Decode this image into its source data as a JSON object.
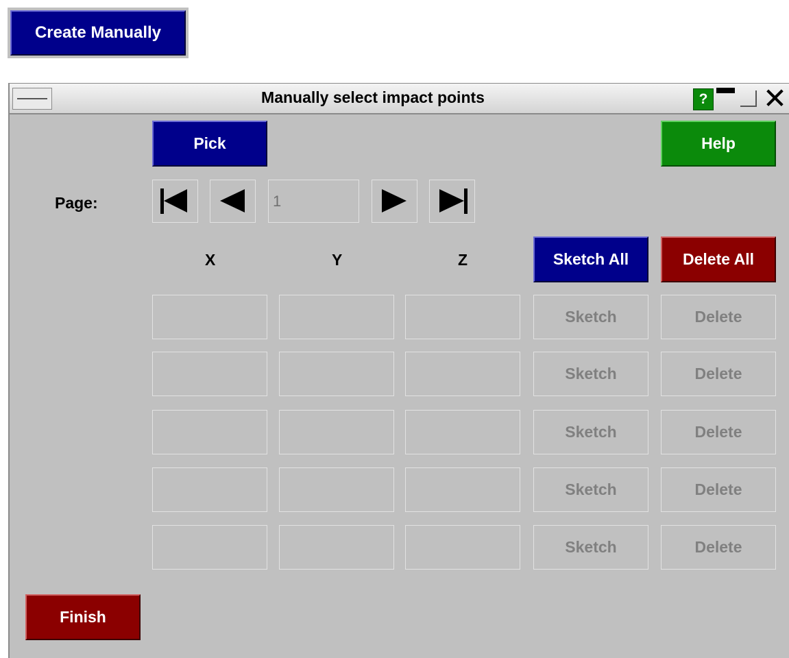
{
  "top_button": {
    "label": "Create Manually"
  },
  "window": {
    "title": "Manually select impact points",
    "help_icon": "?",
    "close_icon": "✕"
  },
  "buttons": {
    "pick": "Pick",
    "help": "Help",
    "sketch_all": "Sketch All",
    "delete_all": "Delete All",
    "finish": "Finish"
  },
  "pager": {
    "label": "Page:",
    "value": "1"
  },
  "columns": {
    "x": "X",
    "y": "Y",
    "z": "Z"
  },
  "rows": [
    {
      "x": "",
      "y": "",
      "z": "",
      "sketch": "Sketch",
      "delete": "Delete"
    },
    {
      "x": "",
      "y": "",
      "z": "",
      "sketch": "Sketch",
      "delete": "Delete"
    },
    {
      "x": "",
      "y": "",
      "z": "",
      "sketch": "Sketch",
      "delete": "Delete"
    },
    {
      "x": "",
      "y": "",
      "z": "",
      "sketch": "Sketch",
      "delete": "Delete"
    },
    {
      "x": "",
      "y": "",
      "z": "",
      "sketch": "Sketch",
      "delete": "Delete"
    }
  ],
  "icons": [
    "first-page-icon",
    "prev-page-icon",
    "next-page-icon",
    "last-page-icon",
    "help-icon",
    "minimize-icon",
    "maximize-icon",
    "close-icon",
    "system-menu-icon"
  ],
  "colors": {
    "blue_button": "#00008b",
    "green_button": "#0b8a0b",
    "red_button": "#8b0000",
    "panel_gray": "#c0c0c0"
  }
}
